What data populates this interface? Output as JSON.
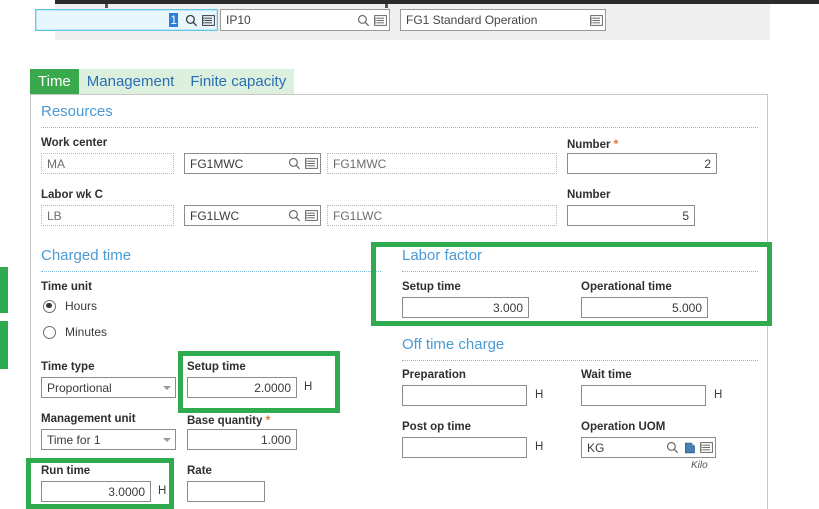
{
  "toolbar": {
    "fields": [
      {
        "name": "sequence-field",
        "value": "1",
        "selected": true,
        "icons": [
          "search-icon",
          "lookup-icon"
        ]
      },
      {
        "name": "operation-code-field",
        "value": "IP10",
        "selected": false,
        "icons": [
          "search-icon",
          "lookup-icon"
        ]
      },
      {
        "name": "operation-description-field",
        "value": "FG1 Standard Operation",
        "selected": false,
        "icons": [
          "lookup-icon"
        ]
      }
    ]
  },
  "tabs": [
    {
      "label": "Time",
      "active": true
    },
    {
      "label": "Management",
      "active": false
    },
    {
      "label": "Finite capacity",
      "active": false
    }
  ],
  "sections": {
    "resources": {
      "title": "Resources",
      "work_center": {
        "label": "Work center",
        "type_code": "MA",
        "code": "FG1MWC",
        "description": "FG1MWC",
        "number_label": "Number",
        "number_required": "*",
        "number_value": "2"
      },
      "labor_wk_c": {
        "label": "Labor wk C",
        "type_code": "LB",
        "code": "FG1LWC",
        "description": "FG1LWC",
        "number_label": "Number",
        "number_value": "5"
      }
    },
    "charged_time": {
      "title": "Charged time",
      "time_unit_label": "Time unit",
      "time_unit_options": [
        {
          "label": "Hours",
          "selected": true
        },
        {
          "label": "Minutes",
          "selected": false
        }
      ],
      "time_type_label": "Time type",
      "time_type_value": "Proportional",
      "setup_time_label": "Setup time",
      "setup_time_value": "2.0000",
      "setup_time_unit": "H",
      "management_unit_label": "Management unit",
      "management_unit_value": "Time for 1",
      "base_quantity_label": "Base quantity",
      "base_quantity_required": "*",
      "base_quantity_value": "1.000",
      "run_time_label": "Run time",
      "run_time_value": "3.0000",
      "run_time_unit": "H",
      "rate_label": "Rate",
      "rate_value": ""
    },
    "labor_factor": {
      "title": "Labor factor",
      "setup_time_label": "Setup time",
      "setup_time_value": "3.000",
      "operational_time_label": "Operational time",
      "operational_time_value": "5.000"
    },
    "off_time_charge": {
      "title": "Off time charge",
      "preparation_label": "Preparation",
      "preparation_value": "",
      "preparation_unit": "H",
      "wait_time_label": "Wait time",
      "wait_time_value": "",
      "wait_time_unit": "H",
      "post_op_time_label": "Post op time",
      "post_op_time_value": "",
      "post_op_time_unit": "H",
      "operation_uom_label": "Operation UOM",
      "operation_uom_value": "KG",
      "operation_uom_note": "Kilo"
    }
  },
  "colors": {
    "highlight_green": "#2faa4f",
    "tab_active_green": "#3aa84c",
    "tab_inactive_green": "#ddf0de",
    "section_blue": "#4a9ad4",
    "required_orange": "#e8762c",
    "selection_blue": "#2b7fd4"
  }
}
